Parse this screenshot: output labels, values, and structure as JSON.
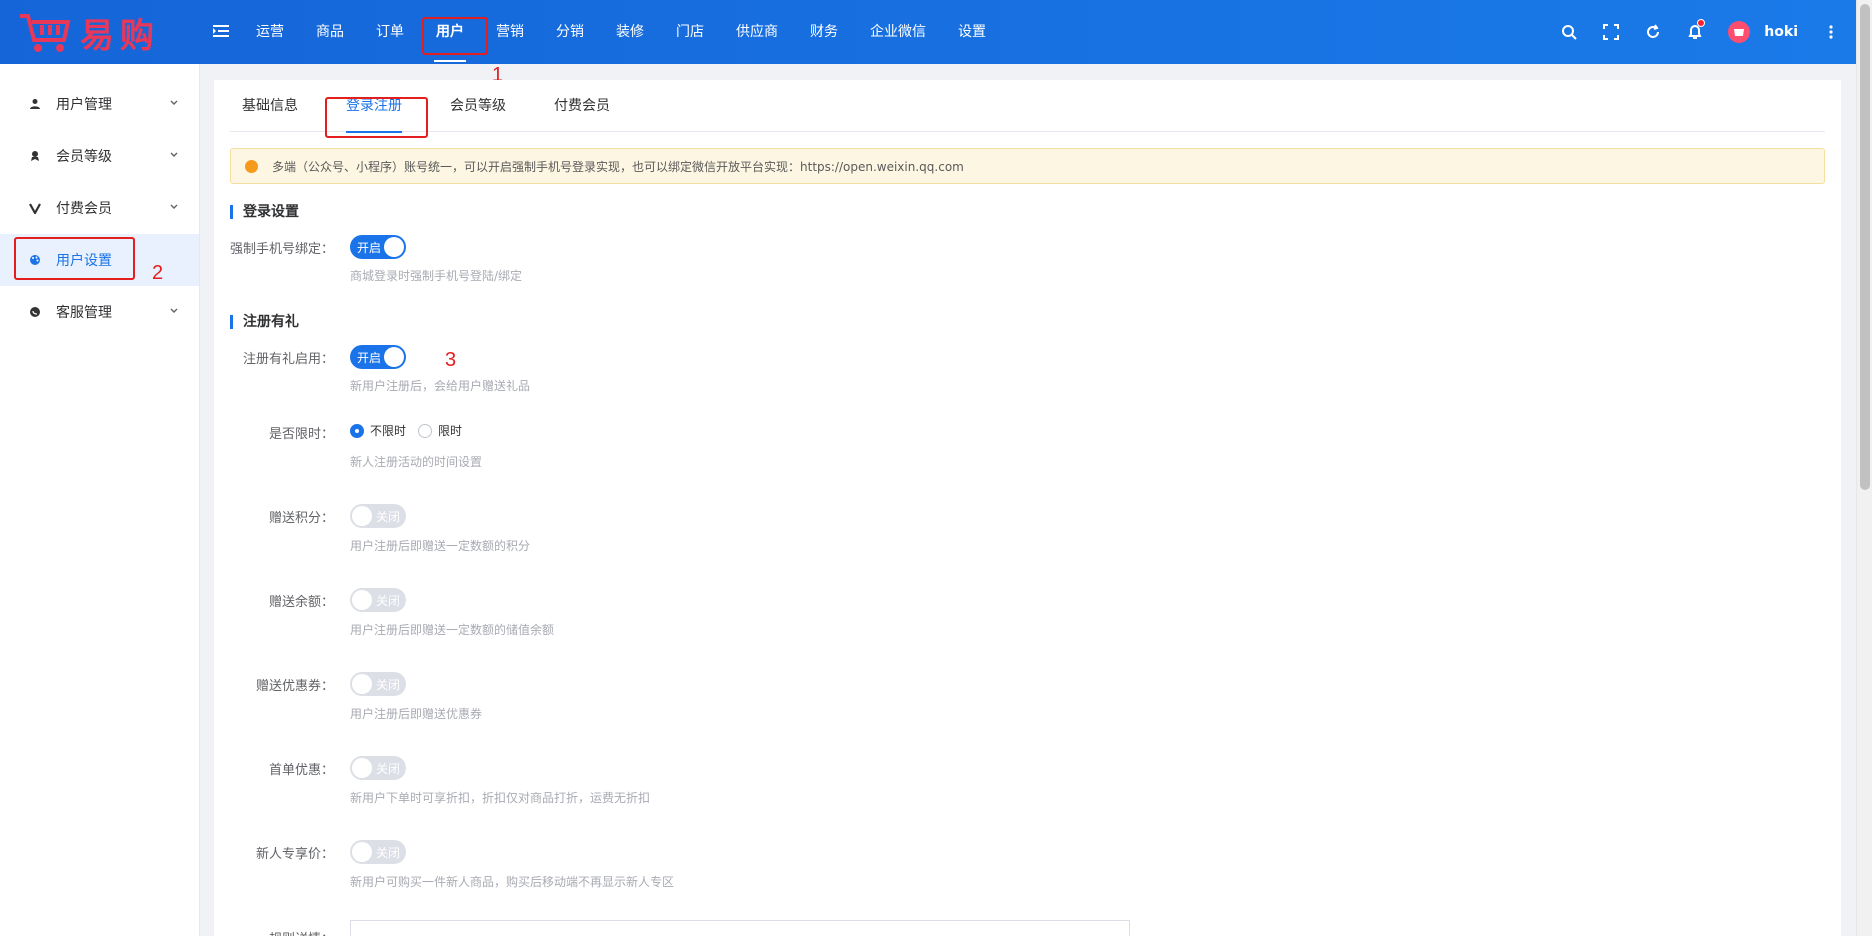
{
  "brand": {
    "name": "易购"
  },
  "header": {
    "nav": [
      "运营",
      "商品",
      "订单",
      "用户",
      "营销",
      "分销",
      "装修",
      "门店",
      "供应商",
      "财务",
      "企业微信",
      "设置"
    ],
    "active_nav_index": 3,
    "username": "hoki",
    "icons": [
      "search-icon",
      "fullscreen-icon",
      "refresh-icon",
      "bell-icon",
      "more-icon"
    ]
  },
  "annotations": {
    "n1": "1",
    "n2": "2",
    "n3": "3",
    "color": "#e41e1e"
  },
  "sidebar": {
    "items": [
      {
        "label": "用户管理",
        "icon": "user-icon"
      },
      {
        "label": "会员等级",
        "icon": "vip-icon"
      },
      {
        "label": "付费会员",
        "icon": "v-icon"
      },
      {
        "label": "用户设置",
        "icon": "palette-icon"
      },
      {
        "label": "客服管理",
        "icon": "chat-icon"
      }
    ],
    "active_index": 3
  },
  "tabs": [
    "基础信息",
    "登录注册",
    "会员等级",
    "付费会员"
  ],
  "active_tab_index": 1,
  "notice": "多端（公众号、小程序）账号统一，可以开启强制手机号登录实现，也可以绑定微信开放平台实现：https://open.weixin.qq.com",
  "login_section": {
    "title": "登录设置",
    "force_phone": {
      "label": "强制手机号绑定：",
      "switch": "开启",
      "hint": "商城登录时强制手机号登陆/绑定"
    }
  },
  "register_section": {
    "title": "注册有礼",
    "enable": {
      "label": "注册有礼启用：",
      "switch": "开启",
      "hint": "新用户注册后，会给用户赠送礼品"
    },
    "time_limit": {
      "label": "是否限时：",
      "options": [
        "不限时",
        "限时"
      ],
      "selected": 0,
      "hint": "新人注册活动的时间设置"
    },
    "points": {
      "label": "赠送积分：",
      "switch": "关闭",
      "hint": "用户注册后即赠送一定数额的积分"
    },
    "balance": {
      "label": "赠送余额：",
      "switch": "关闭",
      "hint": "用户注册后即赠送一定数额的储值余额"
    },
    "coupon": {
      "label": "赠送优惠券：",
      "switch": "关闭",
      "hint": "用户注册后即赠送优惠券"
    },
    "first_order": {
      "label": "首单优惠：",
      "switch": "关闭",
      "hint": "新用户下单时可享折扣，折扣仅对商品打折，运费无折扣"
    },
    "new_price": {
      "label": "新人专享价：",
      "switch": "关闭",
      "hint": "新用户可购买一件新人商品，购买后移动端不再显示新人专区"
    },
    "rules": {
      "label": "规则详情："
    }
  },
  "colors": {
    "primary": "#1a73e8",
    "highlight": "#e41e1e",
    "notice_bg": "#fdf6e3"
  }
}
